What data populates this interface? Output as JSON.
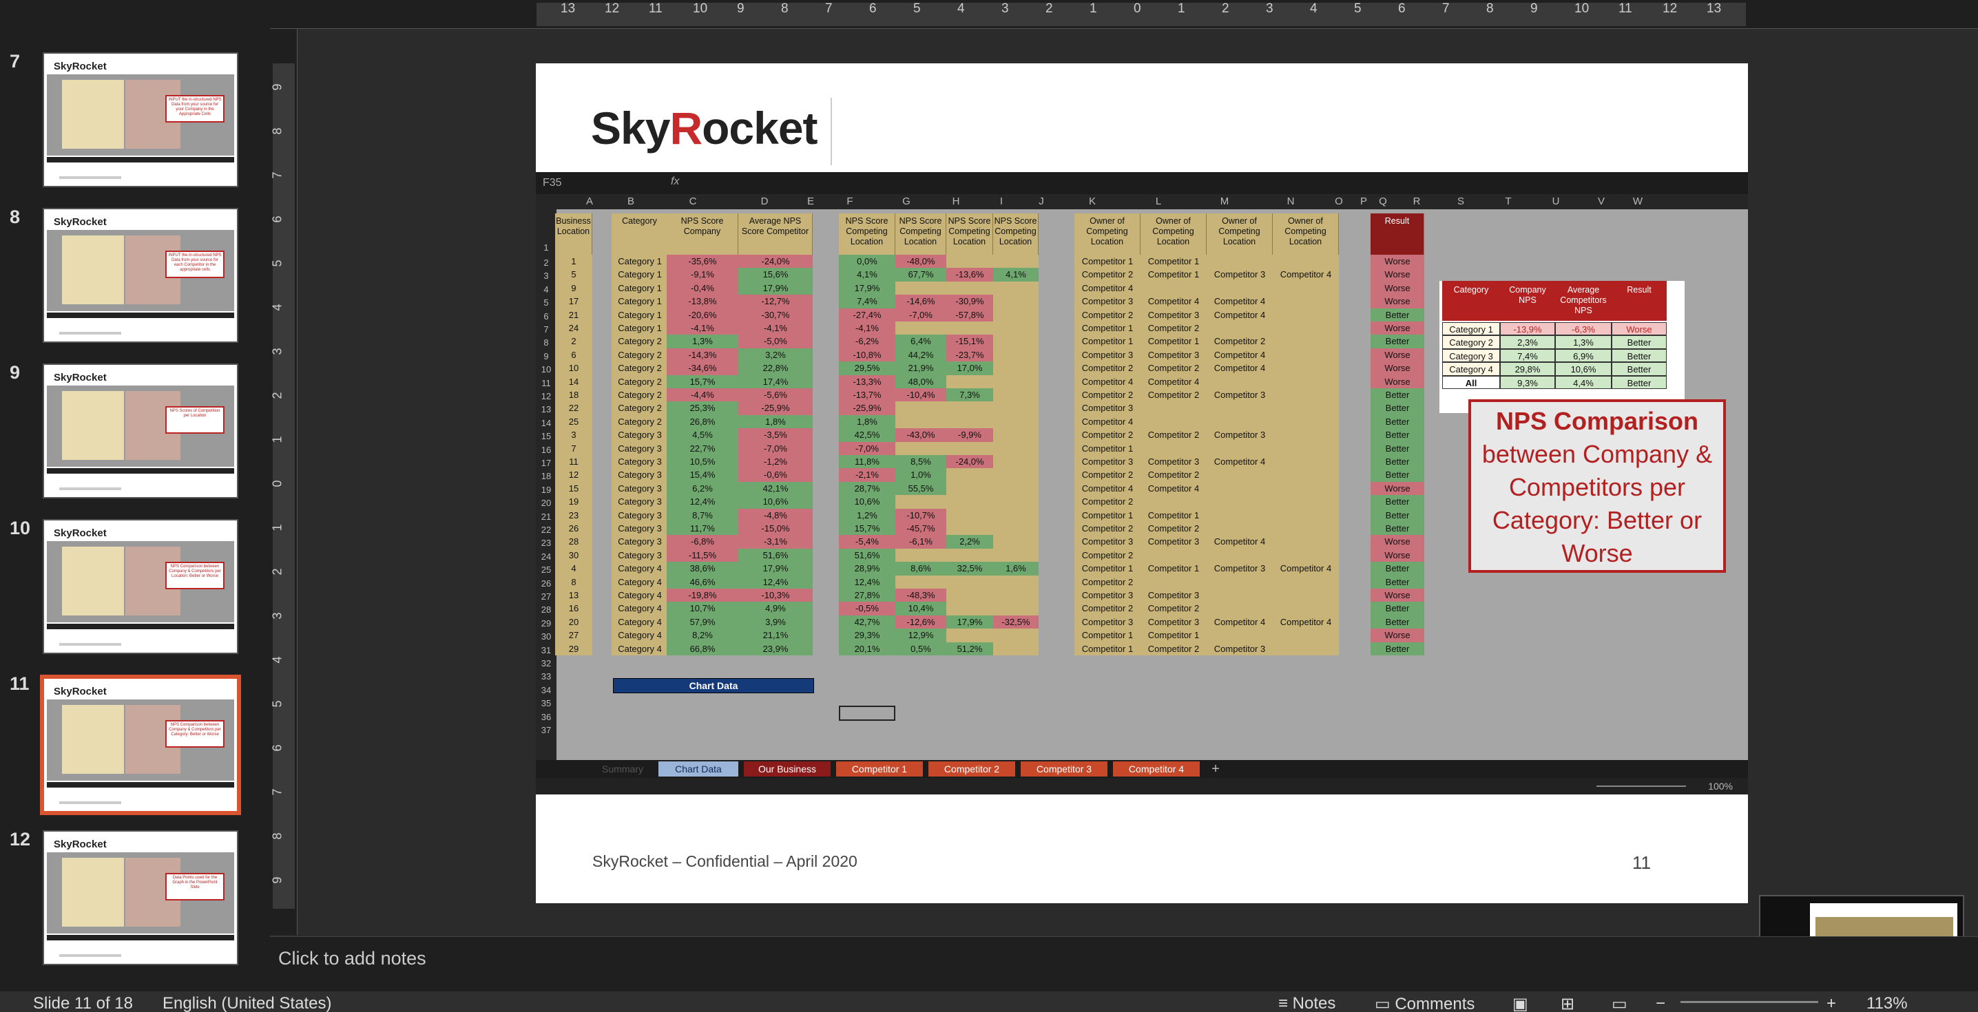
{
  "thumbnails": [
    {
      "num": "7",
      "caption": "INPUT the in-structured NPS Data from your source for your Company in the Appropriate Cells"
    },
    {
      "num": "8",
      "caption": "INPUT the in-structured NPS Data from your source for each Competitor in the appropriate cells"
    },
    {
      "num": "9",
      "caption": "NPS Scores of Competition per Location"
    },
    {
      "num": "10",
      "caption": "NPS Comparison between Company & Competitors per Location: Better or Worse"
    },
    {
      "num": "11",
      "caption": "NPS Comparison between Company & Competitors per Category: Better or Worse"
    },
    {
      "num": "12",
      "caption": "Data Points used for the Graph in the PowerPoint Slide"
    }
  ],
  "thumb_logo": "SkyRocket",
  "ruler_h": [
    "13",
    "12",
    "11",
    "10",
    "9",
    "8",
    "7",
    "6",
    "5",
    "4",
    "3",
    "2",
    "1",
    "0",
    "1",
    "2",
    "3",
    "4",
    "5",
    "6",
    "7",
    "8",
    "9",
    "10",
    "11",
    "12",
    "13"
  ],
  "ruler_v": [
    "9",
    "8",
    "7",
    "6",
    "5",
    "4",
    "3",
    "2",
    "1",
    "0",
    "1",
    "2",
    "3",
    "4",
    "5",
    "6",
    "7",
    "8",
    "9"
  ],
  "slide": {
    "logo_a": "Sky",
    "logo_r": "R",
    "logo_b": "ocket",
    "footer": "SkyRocket – Confidential – April 2020",
    "page": "11",
    "callout_bold": "NPS Comparison",
    "callout_rest": "between Company & Competitors per Category: Better or Worse"
  },
  "excel": {
    "cell_ref": "F35",
    "fx": "fx",
    "columns": [
      "A",
      "B",
      "C",
      "D",
      "E",
      "F",
      "G",
      "H",
      "I",
      "J",
      "K",
      "L",
      "M",
      "N",
      "O",
      "P",
      "Q",
      "R",
      "S",
      "T",
      "U",
      "V",
      "W"
    ],
    "headers": {
      "a": "Business Location",
      "b": "Category",
      "c": "NPS Score Company",
      "d": "Average NPS Score Competitor",
      "f": "NPS Score Competing Location",
      "g": "NPS Score Competing Location",
      "h": "NPS Score Competing Location",
      "i": "NPS Score Competing Location",
      "k": "Owner of Competing Location",
      "l": "Owner of Competing Location",
      "m": "Owner of Competing Location",
      "n": "Owner of Competing Location",
      "p": "Result"
    },
    "rows": [
      [
        "1",
        "Category 1",
        "-35,6%",
        "-24,0%",
        "0,0%",
        "-48,0%",
        "",
        "",
        "Competitor 1",
        "Competitor 1",
        "",
        "",
        "Worse"
      ],
      [
        "5",
        "Category 1",
        "-9,1%",
        "15,6%",
        "4,1%",
        "67,7%",
        "-13,6%",
        "4,1%",
        "Competitor 2",
        "Competitor 1",
        "Competitor 3",
        "Competitor 4",
        "Worse"
      ],
      [
        "9",
        "Category 1",
        "-0,4%",
        "17,9%",
        "17,9%",
        "",
        "",
        "",
        "Competitor 4",
        "",
        "",
        "",
        "Worse"
      ],
      [
        "17",
        "Category 1",
        "-13,8%",
        "-12,7%",
        "7,4%",
        "-14,6%",
        "-30,9%",
        "",
        "Competitor 3",
        "Competitor 4",
        "Competitor 4",
        "",
        "Worse"
      ],
      [
        "21",
        "Category 1",
        "-20,6%",
        "-30,7%",
        "-27,4%",
        "-7,0%",
        "-57,8%",
        "",
        "Competitor 2",
        "Competitor 3",
        "Competitor 4",
        "",
        "Better"
      ],
      [
        "24",
        "Category 1",
        "-4,1%",
        "-4,1%",
        "-4,1%",
        "",
        "",
        "",
        "Competitor 1",
        "Competitor 2",
        "",
        "",
        "Worse"
      ],
      [
        "2",
        "Category 2",
        "1,3%",
        "-5,0%",
        "-6,2%",
        "6,4%",
        "-15,1%",
        "",
        "Competitor 1",
        "Competitor 1",
        "Competitor 2",
        "",
        "Better"
      ],
      [
        "6",
        "Category 2",
        "-14,3%",
        "3,2%",
        "-10,8%",
        "44,2%",
        "-23,7%",
        "",
        "Competitor 3",
        "Competitor 3",
        "Competitor 4",
        "",
        "Worse"
      ],
      [
        "10",
        "Category 2",
        "-34,6%",
        "22,8%",
        "29,5%",
        "21,9%",
        "17,0%",
        "",
        "Competitor 2",
        "Competitor 2",
        "Competitor 4",
        "",
        "Worse"
      ],
      [
        "14",
        "Category 2",
        "15,7%",
        "17,4%",
        "-13,3%",
        "48,0%",
        "",
        "",
        "Competitor 4",
        "Competitor 4",
        "",
        "",
        "Worse"
      ],
      [
        "18",
        "Category 2",
        "-4,4%",
        "-5,6%",
        "-13,7%",
        "-10,4%",
        "7,3%",
        "",
        "Competitor 2",
        "Competitor 2",
        "Competitor 3",
        "",
        "Better"
      ],
      [
        "22",
        "Category 2",
        "25,3%",
        "-25,9%",
        "-25,9%",
        "",
        "",
        "",
        "Competitor 3",
        "",
        "",
        "",
        "Better"
      ],
      [
        "25",
        "Category 2",
        "26,8%",
        "1,8%",
        "1,8%",
        "",
        "",
        "",
        "Competitor 4",
        "",
        "",
        "",
        "Better"
      ],
      [
        "3",
        "Category 3",
        "4,5%",
        "-3,5%",
        "42,5%",
        "-43,0%",
        "-9,9%",
        "",
        "Competitor 2",
        "Competitor 2",
        "Competitor 3",
        "",
        "Better"
      ],
      [
        "7",
        "Category 3",
        "22,7%",
        "-7,0%",
        "-7,0%",
        "",
        "",
        "",
        "Competitor 1",
        "",
        "",
        "",
        "Better"
      ],
      [
        "11",
        "Category 3",
        "10,5%",
        "-1,2%",
        "11,8%",
        "8,5%",
        "-24,0%",
        "",
        "Competitor 3",
        "Competitor 3",
        "Competitor 4",
        "",
        "Better"
      ],
      [
        "12",
        "Category 3",
        "15,4%",
        "-0,6%",
        "-2,1%",
        "1,0%",
        "",
        "",
        "Competitor 2",
        "Competitor 2",
        "",
        "",
        "Better"
      ],
      [
        "15",
        "Category 3",
        "6,2%",
        "42,1%",
        "28,7%",
        "55,5%",
        "",
        "",
        "Competitor 4",
        "Competitor 4",
        "",
        "",
        "Worse"
      ],
      [
        "19",
        "Category 3",
        "12,4%",
        "10,6%",
        "10,6%",
        "",
        "",
        "",
        "Competitor 2",
        "",
        "",
        "",
        "Better"
      ],
      [
        "23",
        "Category 3",
        "8,7%",
        "-4,8%",
        "1,2%",
        "-10,7%",
        "",
        "",
        "Competitor 1",
        "Competitor 1",
        "",
        "",
        "Better"
      ],
      [
        "26",
        "Category 3",
        "11,7%",
        "-15,0%",
        "15,7%",
        "-45,7%",
        "",
        "",
        "Competitor 2",
        "Competitor 2",
        "",
        "",
        "Better"
      ],
      [
        "28",
        "Category 3",
        "-6,8%",
        "-3,1%",
        "-5,4%",
        "-6,1%",
        "2,2%",
        "",
        "Competitor 3",
        "Competitor 3",
        "Competitor 4",
        "",
        "Worse"
      ],
      [
        "30",
        "Category 3",
        "-11,5%",
        "51,6%",
        "51,6%",
        "",
        "",
        "",
        "Competitor 2",
        "",
        "",
        "",
        "Worse"
      ],
      [
        "4",
        "Category 4",
        "38,6%",
        "17,9%",
        "28,9%",
        "8,6%",
        "32,5%",
        "1,6%",
        "Competitor 1",
        "Competitor 1",
        "Competitor 3",
        "Competitor 4",
        "Better"
      ],
      [
        "8",
        "Category 4",
        "46,6%",
        "12,4%",
        "12,4%",
        "",
        "",
        "",
        "Competitor 2",
        "",
        "",
        "",
        "Better"
      ],
      [
        "13",
        "Category 4",
        "-19,8%",
        "-10,3%",
        "27,8%",
        "-48,3%",
        "",
        "",
        "Competitor 3",
        "Competitor 3",
        "",
        "",
        "Worse"
      ],
      [
        "16",
        "Category 4",
        "10,7%",
        "4,9%",
        "-0,5%",
        "10,4%",
        "",
        "",
        "Competitor 2",
        "Competitor 2",
        "",
        "",
        "Better"
      ],
      [
        "20",
        "Category 4",
        "57,9%",
        "3,9%",
        "42,7%",
        "-12,6%",
        "17,9%",
        "-32,5%",
        "Competitor 3",
        "Competitor 3",
        "Competitor 4",
        "Competitor 4",
        "Better"
      ],
      [
        "27",
        "Category 4",
        "8,2%",
        "21,1%",
        "29,3%",
        "12,9%",
        "",
        "",
        "Competitor 1",
        "Competitor 1",
        "",
        "",
        "Worse"
      ],
      [
        "29",
        "Category 4",
        "66,8%",
        "23,9%",
        "20,1%",
        "0,5%",
        "51,2%",
        "",
        "Competitor 1",
        "Competitor 2",
        "Competitor 3",
        "",
        "Better"
      ]
    ],
    "summary": {
      "headers": [
        "Category",
        "Company NPS",
        "Average Competitors NPS",
        "Result"
      ],
      "rows": [
        [
          "Category 1",
          "-13,9%",
          "-6,3%",
          "Worse"
        ],
        [
          "Category 2",
          "2,3%",
          "1,3%",
          "Better"
        ],
        [
          "Category 3",
          "7,4%",
          "6,9%",
          "Better"
        ],
        [
          "Category 4",
          "29,8%",
          "10,6%",
          "Better"
        ],
        [
          "All",
          "9,3%",
          "4,4%",
          "Better"
        ]
      ]
    },
    "chart_button": "Chart Data",
    "tabs": [
      "Summary",
      "Chart Data",
      "Our Business",
      "Competitor 1",
      "Competitor 2",
      "Competitor 3",
      "Competitor 4",
      "+"
    ],
    "zoom": "100%"
  },
  "notes_placeholder": "Click to add notes",
  "statusbar": {
    "slide": "Slide 11 of 18",
    "language": "English (United States)",
    "notes": "Notes",
    "comments": "Comments",
    "zoom": "113%"
  }
}
